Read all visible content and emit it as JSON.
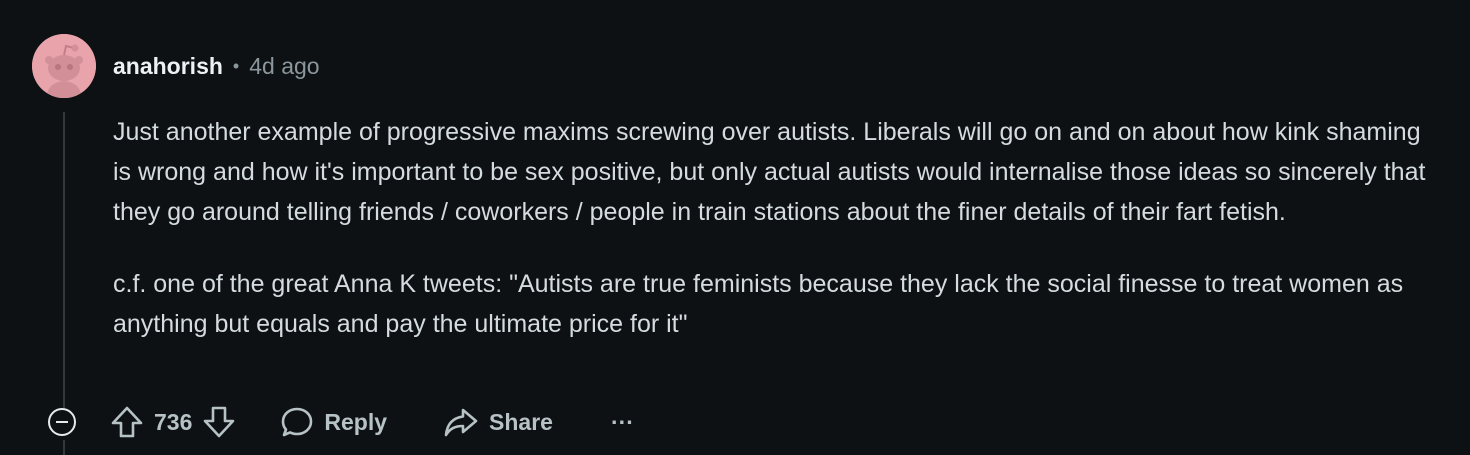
{
  "comment": {
    "author": "anahorish",
    "separator": "•",
    "time": "4d ago",
    "paragraphs": [
      "Just another example of progressive maxims screwing over autists. Liberals will go on and on about how kink shaming is wrong and how it's important to be sex positive, but only actual autists would internalise those ideas so sincerely that they go around telling friends / coworkers / people in train stations about the finer details of their fart fetish.",
      "c.f. one of the great Anna K tweets: \"Autists are true feminists because they lack the social finesse to treat women as anything but equals and pay the ultimate price for it\""
    ],
    "score": "736"
  },
  "actions": {
    "reply_label": "Reply",
    "share_label": "Share",
    "more_label": "···"
  },
  "icons": {
    "avatar": "default-snoo-avatar-icon",
    "collapse": "collapse-minus-icon",
    "upvote": "upvote-arrow-icon",
    "downvote": "downvote-arrow-icon",
    "reply": "speech-bubble-icon",
    "share": "share-arrow-icon",
    "more": "ellipsis-icon"
  },
  "colors": {
    "background": "#0e1113",
    "avatar_bg": "#e8a3ab",
    "text": "#d4dcdf",
    "muted": "#8b979c"
  }
}
